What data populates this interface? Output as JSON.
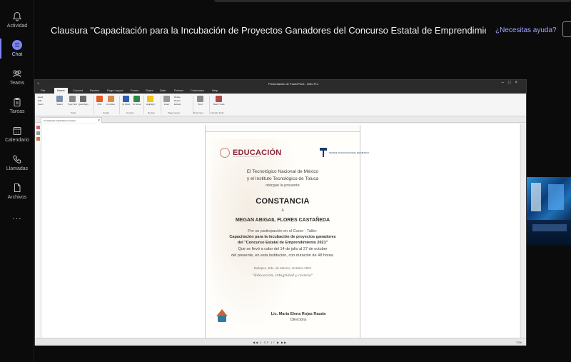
{
  "teams_rail": {
    "items": [
      {
        "label": "Actividad",
        "icon": "bell-icon"
      },
      {
        "label": "Chat",
        "icon": "chat-icon",
        "active": true
      },
      {
        "label": "Teams",
        "icon": "teams-icon"
      },
      {
        "label": "Tareas",
        "icon": "clipboard-icon"
      },
      {
        "label": "Calendario",
        "icon": "calendar-icon"
      },
      {
        "label": "Llamadas",
        "icon": "phone-icon"
      },
      {
        "label": "Archivos",
        "icon": "file-icon"
      }
    ],
    "more": "..."
  },
  "meeting": {
    "title": "Clausura \"Capacitación para la Incubación de Proyectos Ganadores del Concurso Estatal de Emprendimien...",
    "help_link": "¿Necesitas ayuda?"
  },
  "app": {
    "window_title": "Presentación de PowerPoint - Nitro Pro",
    "menu_tabs": [
      "File",
      "Home",
      "Convert",
      "Review",
      "Page Layout",
      "Forms",
      "Share",
      "Date",
      "Protect",
      "Customize",
      "Help"
    ],
    "selected_tab": "Home",
    "ribbon": {
      "buttons": [
        "Hand",
        "Edit",
        "Zoom",
        "Select",
        "Type Text",
        "QuickSign",
        "PDF",
        "Combine",
        "To Word",
        "To Excel",
        "Highlight",
        "Insert",
        "Rotate",
        "Delete",
        "Extract",
        "Find",
        "Batch Tools"
      ],
      "groups": [
        "Tools",
        "Create",
        "Convert",
        "Review",
        "Page Layout",
        "Document",
        "Favorite Tools"
      ]
    },
    "doc_tab": "Constancias Capacitación para la...",
    "status": {
      "page_indicator": "4 OF 17",
      "zoom": "70%"
    },
    "accent": "#e45b25"
  },
  "certificate": {
    "logo_main": "EDUCACIÓN",
    "logo_main_sub": "SECRETARÍA DE EDUCACIÓN PÚBLICA",
    "logo_secondary": "TECNOLÓGICO NACIONAL DE MÉXICO",
    "line1": "El Tecnológico Nacional de México",
    "line2": "y el Instituto Tecnológico de Toluca",
    "line3": "otorgan la presente",
    "heading": "CONSTANCIA",
    "to": "A",
    "recipient": "MEGAN ABIGAIL FLORES CASTAÑEDA",
    "reason": "Por su participación en el Curso - Taller:",
    "course1": "Capacitación para la incubación de proyectos ganadores",
    "course2": "del \"Concurso Estatal de Emprendimiento 2021\"",
    "dates1": "Que se llevó a cabo del 14 de julio al 27 de octubre",
    "dates2": "del presente, en esta institución, con duración de 48 horas.",
    "place_date": "Metepec, Edo. de México, Octubre 2021",
    "motto": "\"Educación, integridad y ciencia\"",
    "signer": "Lic. María Elena Rojas Rauda",
    "signer_role": "Directora"
  }
}
